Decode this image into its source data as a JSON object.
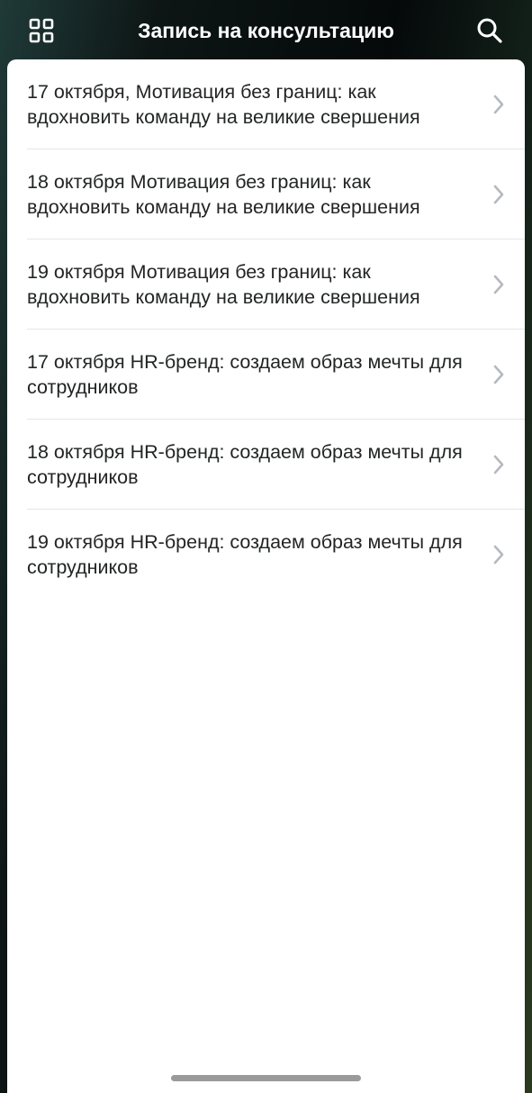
{
  "header": {
    "title": "Запись на консультацию",
    "left_icon": "grid-icon",
    "right_icon": "search-icon",
    "text_color": "#ffffff"
  },
  "list": {
    "items": [
      {
        "label": "17 октября, Мотивация без границ: как вдохновить команду на великие свершения"
      },
      {
        "label": "18 октября Мотивация без границ: как вдохновить команду на великие свершения"
      },
      {
        "label": "19 октября Мотивация без границ: как вдохновить команду на великие свершения"
      },
      {
        "label": "17 октября HR-бренд: создаем образ мечты для сотрудников"
      },
      {
        "label": "18 октября HR-бренд: создаем образ мечты для сотрудников"
      },
      {
        "label": "19 октября HR-бренд: создаем образ мечты для сотрудников"
      }
    ],
    "item_icon": "chevron-right-icon",
    "chevron_color": "#b5b9bf",
    "divider_color": "#e4e6ea"
  }
}
